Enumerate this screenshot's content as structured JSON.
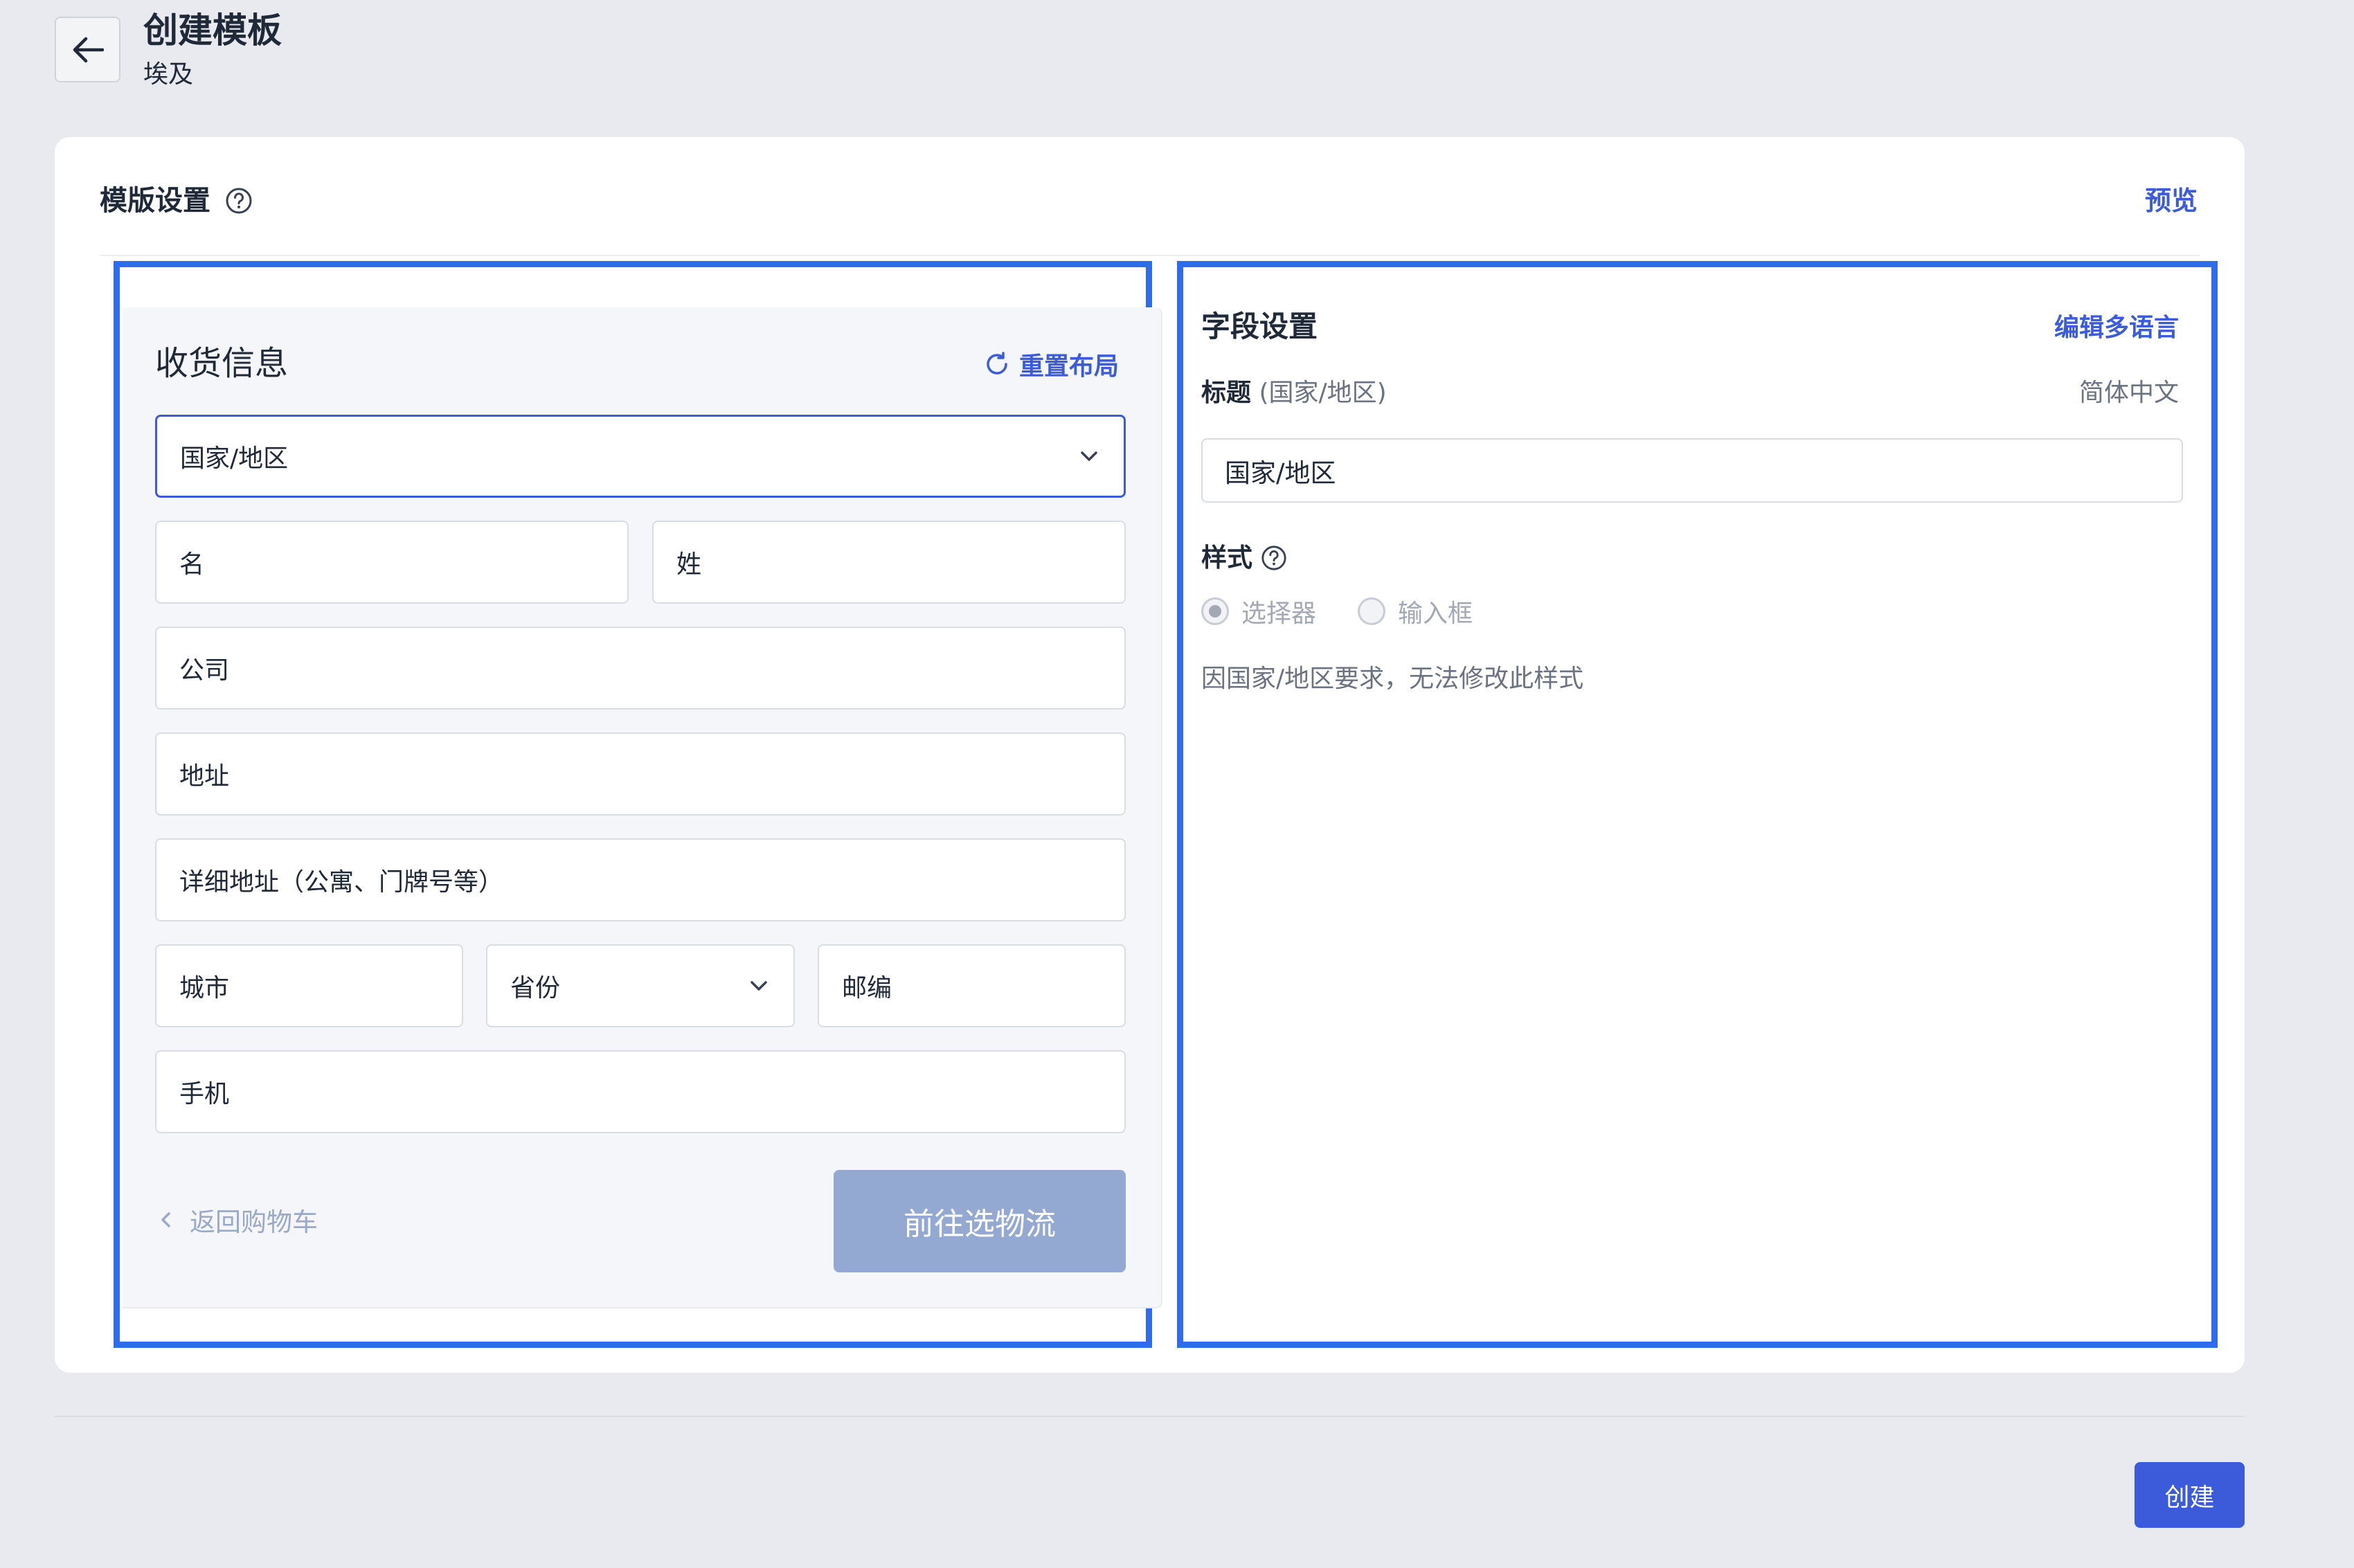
{
  "header": {
    "title": "创建模板",
    "subtitle": "埃及"
  },
  "card": {
    "title": "模版设置",
    "preview_label": "预览"
  },
  "checkout_preview": {
    "heading": "收货信息",
    "reset_layout_label": "重置布局",
    "fields": {
      "country": "国家/地区",
      "first_name": "名",
      "last_name": "姓",
      "company": "公司",
      "address": "地址",
      "address_detail": "详细地址（公寓、门牌号等）",
      "city": "城市",
      "province": "省份",
      "postal_code": "邮编",
      "phone": "手机"
    },
    "back_to_cart_label": "返回购物车",
    "continue_shipping_label": "前往选物流"
  },
  "field_settings": {
    "title": "字段设置",
    "edit_languages_label": "编辑多语言",
    "label_title": "标题",
    "label_field_name": "(国家/地区)",
    "language": "简体中文",
    "title_value": "国家/地区",
    "style_label": "样式",
    "style_options": {
      "selector": "选择器",
      "input": "输入框"
    },
    "selected_style": "选择器",
    "note": "因国家/地区要求，无法修改此样式"
  },
  "footer": {
    "create_label": "创建"
  },
  "colors": {
    "accent": "#3b5bdb",
    "highlight_frame": "#2f6bed",
    "disabled_button": "#93a9d1",
    "page_background": "#e8eaef"
  }
}
